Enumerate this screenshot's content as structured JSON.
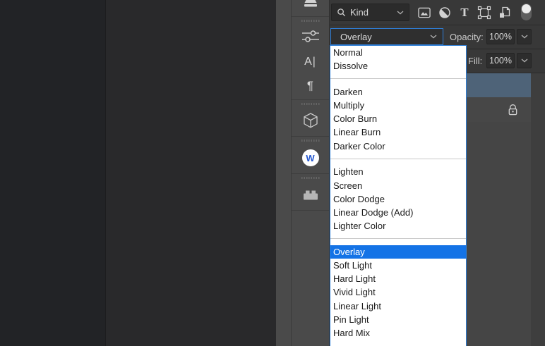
{
  "layers_panel": {
    "filter_row": {
      "kind": "Kind",
      "filter_icon_names": [
        "picture-filter-icon",
        "adjustment-filter-icon",
        "type-filter-icon",
        "shape-filter-icon",
        "smart-object-filter-icon",
        "filter-toggle-switch"
      ],
      "toggle_state": "on"
    },
    "blend_mode": {
      "selected": "Overlay"
    },
    "opacity": {
      "label": "Opacity:",
      "value": "100%"
    },
    "fill": {
      "label": "Fill:",
      "value": "100%"
    }
  },
  "blend_dropdown": {
    "selected": "Overlay",
    "groups": [
      [
        "Normal",
        "Dissolve"
      ],
      [
        "Darken",
        "Multiply",
        "Color Burn",
        "Linear Burn",
        "Darker Color"
      ],
      [
        "Lighten",
        "Screen",
        "Color Dodge",
        "Linear Dodge (Add)",
        "Lighter Color"
      ],
      [
        "Overlay",
        "Soft Light",
        "Hard Light",
        "Vivid Light",
        "Linear Light",
        "Pin Light",
        "Hard Mix"
      ]
    ]
  },
  "sidebar": {
    "icon_names": [
      "clone-stamp-icon",
      "sliders-icon",
      "character-panel-icon",
      "paragraph-panel-icon",
      "cube-3d-icon",
      "w-plugin-icon",
      "plugins-brick-icon"
    ],
    "character_glyph": "A|",
    "paragraph_glyph": "¶",
    "w_badge": "W"
  },
  "layer_rows": {
    "selected_row": "",
    "locked_row_icon": "padlock"
  },
  "colors": {
    "dropdown_selection": "#1473e6",
    "focus_border": "#2e7ed7",
    "selected_layer_row": "#4e6378",
    "panel_bg": "#383838",
    "dock_bg": "#4a4a4a"
  }
}
